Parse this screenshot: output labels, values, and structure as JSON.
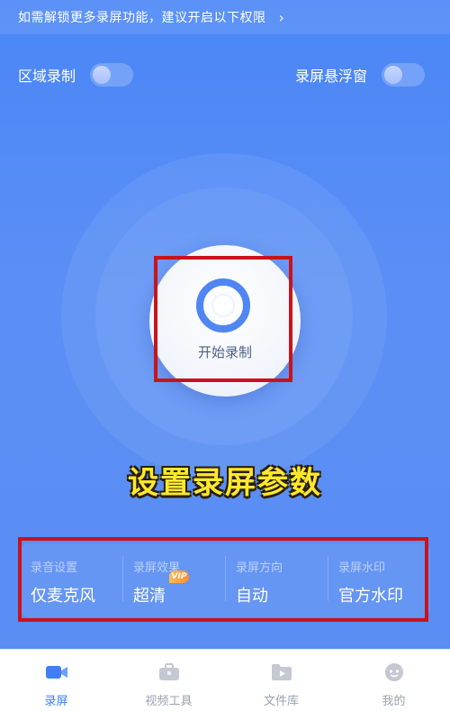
{
  "notice": {
    "text": "如需解锁更多录屏功能，建议开启以下权限",
    "chevron": "›"
  },
  "toggles": {
    "region_label": "区域录制",
    "float_label": "录屏悬浮窗"
  },
  "record": {
    "label": "开始录制"
  },
  "caption": "设置录屏参数",
  "settings": [
    {
      "title": "录音设置",
      "value": "仅麦克风"
    },
    {
      "title": "录屏效果",
      "value": "超清",
      "badge": "VIP"
    },
    {
      "title": "录屏方向",
      "value": "自动"
    },
    {
      "title": "录屏水印",
      "value": "官方水印"
    }
  ],
  "tabs": [
    {
      "label": "录屏",
      "icon": "video-camera-icon",
      "active": true
    },
    {
      "label": "视频工具",
      "icon": "toolbox-icon",
      "active": false
    },
    {
      "label": "文件库",
      "icon": "folder-play-icon",
      "active": false
    },
    {
      "label": "我的",
      "icon": "user-avatar-icon",
      "active": false
    }
  ],
  "colors": {
    "accent": "#3f7ff5",
    "background": "#4a86f7",
    "highlight": "#c9131b",
    "caption": "#ffe830"
  }
}
